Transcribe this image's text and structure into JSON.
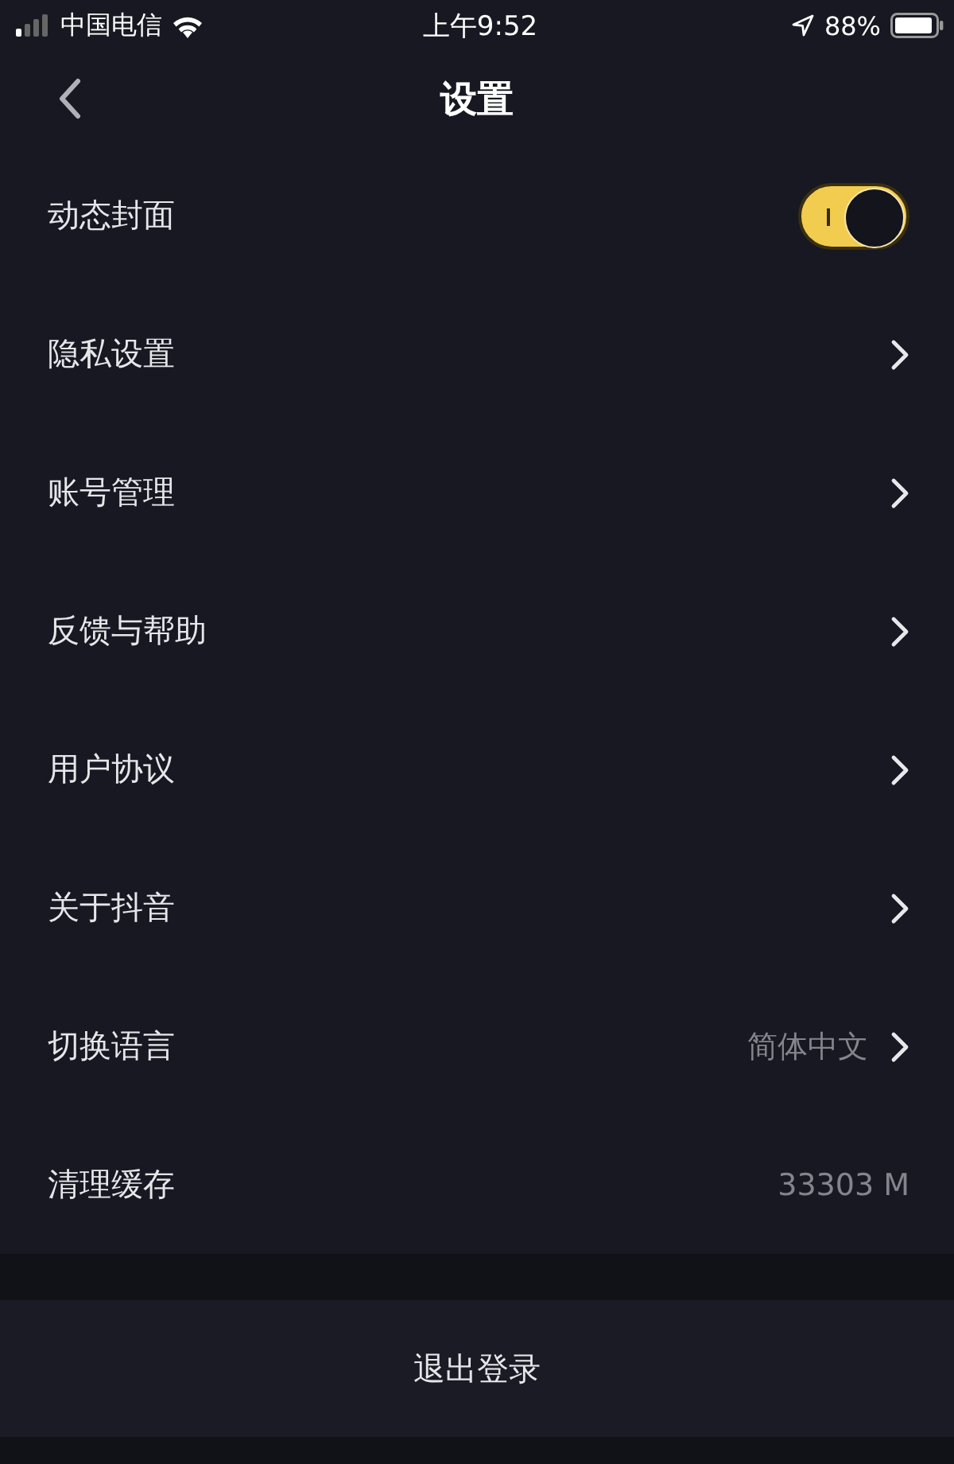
{
  "status_bar": {
    "carrier": "中国电信",
    "time": "上午9:52",
    "battery": "88%"
  },
  "nav": {
    "title": "设置"
  },
  "rows": [
    {
      "kind": "toggle",
      "label": "动态封面",
      "on": true
    },
    {
      "kind": "link",
      "label": "隐私设置"
    },
    {
      "kind": "link",
      "label": "账号管理"
    },
    {
      "kind": "link",
      "label": "反馈与帮助"
    },
    {
      "kind": "link",
      "label": "用户协议"
    },
    {
      "kind": "link",
      "label": "关于抖音"
    },
    {
      "kind": "link",
      "label": "切换语言",
      "value": "简体中文"
    },
    {
      "kind": "value",
      "label": "清理缓存",
      "value": "33303 M"
    }
  ],
  "logout": {
    "label": "退出登录"
  }
}
